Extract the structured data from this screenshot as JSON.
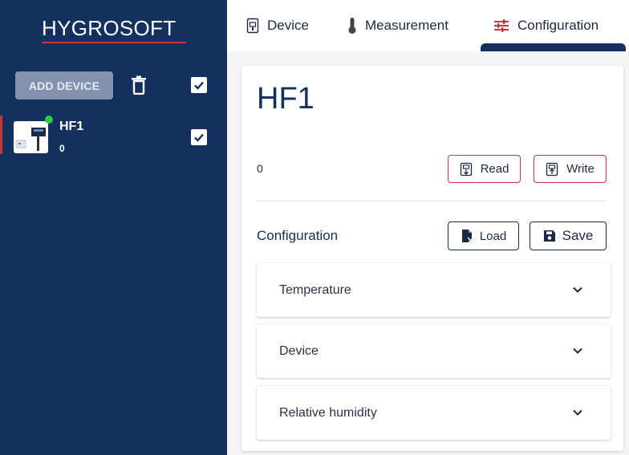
{
  "brand": {
    "name": "HYGROSOFT",
    "accent": "#c8373b",
    "sidebar_bg": "#14305f"
  },
  "sidebar": {
    "add_device_label": "ADD DEVICE",
    "trash_icon": "trash-icon",
    "select_all_checked": true,
    "devices": [
      {
        "name": "HF1",
        "sub": "0",
        "status": "online",
        "status_color": "#2ecc40",
        "checked": true
      }
    ]
  },
  "tabs": [
    {
      "label": "Device",
      "icon": "device-icon",
      "active": false
    },
    {
      "label": "Measurement",
      "icon": "thermometer-icon",
      "active": false
    },
    {
      "label": "Configuration",
      "icon": "sliders-icon",
      "active": true
    }
  ],
  "main": {
    "title": "HF1",
    "value": "0",
    "read_label": "Read",
    "write_label": "Write",
    "configuration_label": "Configuration",
    "load_label": "Load",
    "save_label": "Save",
    "sections": [
      {
        "label": "Temperature",
        "expanded": false
      },
      {
        "label": "Device",
        "expanded": false
      },
      {
        "label": "Relative humidity",
        "expanded": false
      }
    ]
  }
}
